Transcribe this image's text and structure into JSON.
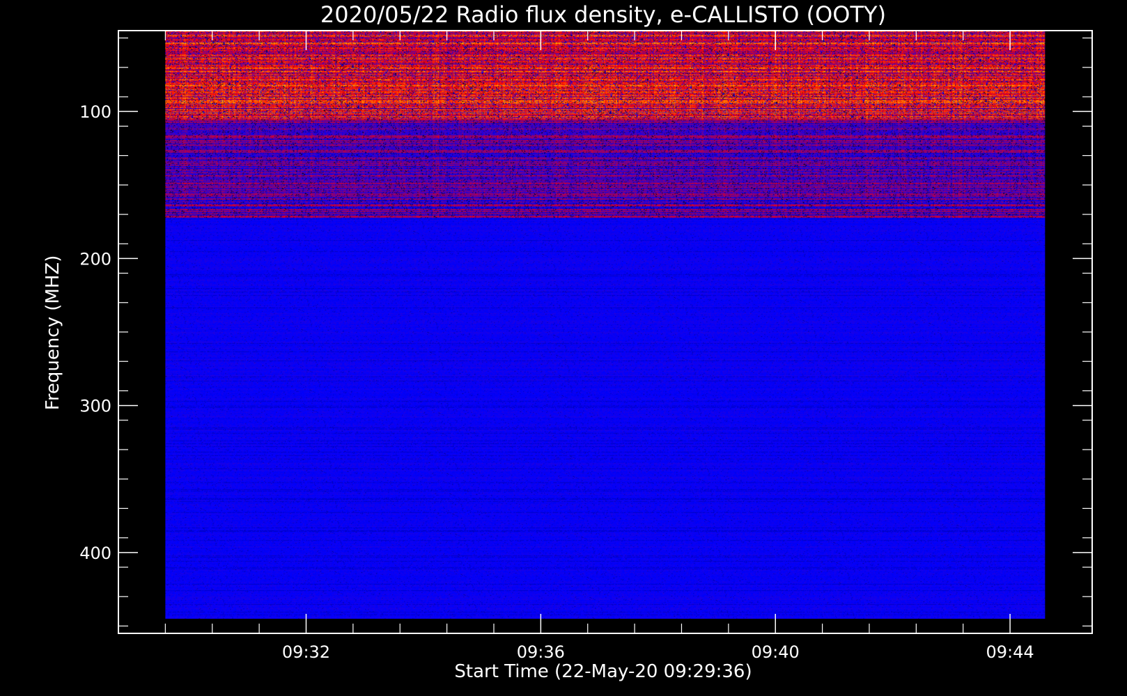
{
  "chart_data": {
    "type": "heatmap",
    "title": "2020/05/22  Radio flux density, e-CALLISTO (OOTY)",
    "xlabel": "Start Time (22-May-20 09:29:36)",
    "ylabel": "Frequency (MHZ)",
    "x_ticks": [
      "09:32",
      "09:36",
      "09:40",
      "09:44"
    ],
    "x_tick_values_min": [
      2.4,
      6.4,
      10.4,
      14.4
    ],
    "xlim_min": [
      -0.8,
      15.8
    ],
    "x_data_range_min": [
      0,
      15
    ],
    "y_ticks": [
      "100",
      "200",
      "300",
      "400"
    ],
    "y_tick_values": [
      100,
      200,
      300,
      400
    ],
    "ylim": [
      45,
      455
    ],
    "y_data_range": [
      45,
      445
    ],
    "y_inverted": true,
    "colormap": [
      "#000000",
      "#0000ff",
      "#ff0000",
      "#ffff00"
    ],
    "background": "#000000",
    "features": [
      {
        "description": "strong interference band (yellow/red/blue stripes)",
        "freq_range": [
          45,
          105
        ]
      },
      {
        "description": "moderate interference band (red/blue stripes)",
        "freq_range": [
          105,
          172
        ]
      },
      {
        "description": "quiet background (blue)",
        "freq_range": [
          172,
          445
        ]
      }
    ]
  }
}
